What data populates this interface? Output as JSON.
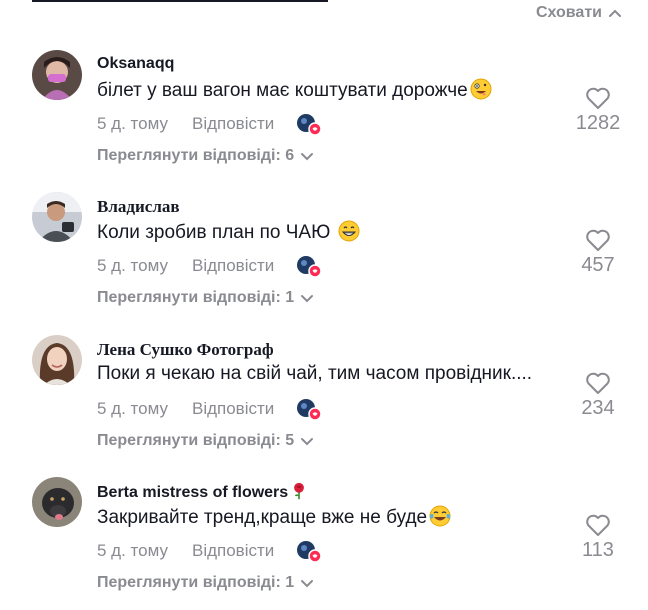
{
  "header": {
    "hide_label": "Сховати"
  },
  "comments": [
    {
      "username": "Oksanaqq",
      "text": "білет у ваш вагон має коштувати дорожче",
      "emoji": "zany-face-emoji",
      "time": "5 д. тому",
      "reply_label": "Відповісти",
      "view_replies": "Переглянути відповіді: 6",
      "likes": "1282"
    },
    {
      "username": "Владислав",
      "text": "Коли зробив план по ЧАЮ ",
      "emoji": "grinning-face-emoji",
      "time": "5 д. тому",
      "reply_label": "Відповісти",
      "view_replies": "Переглянути відповіді: 1",
      "likes": "457"
    },
    {
      "username": "Лена Сушко Фотограф",
      "text": "Поки я чекаю на свій чай, тим часом провідник....",
      "emoji": "",
      "time": "5 д. тому",
      "reply_label": "Відповісти",
      "view_replies": "Переглянути відповіді: 5",
      "likes": "234"
    },
    {
      "username": "Berta mistress of flowers",
      "text": "Закривайте тренд,краще вже не буде",
      "emoji": "tears-of-joy-emoji",
      "time": "5 д. тому",
      "reply_label": "Відповісти",
      "view_replies": "Переглянути відповіді: 1",
      "likes": "113"
    }
  ],
  "colors": {
    "muted": "#8a8b91",
    "text": "#161823",
    "badge": "#fe2c55"
  }
}
